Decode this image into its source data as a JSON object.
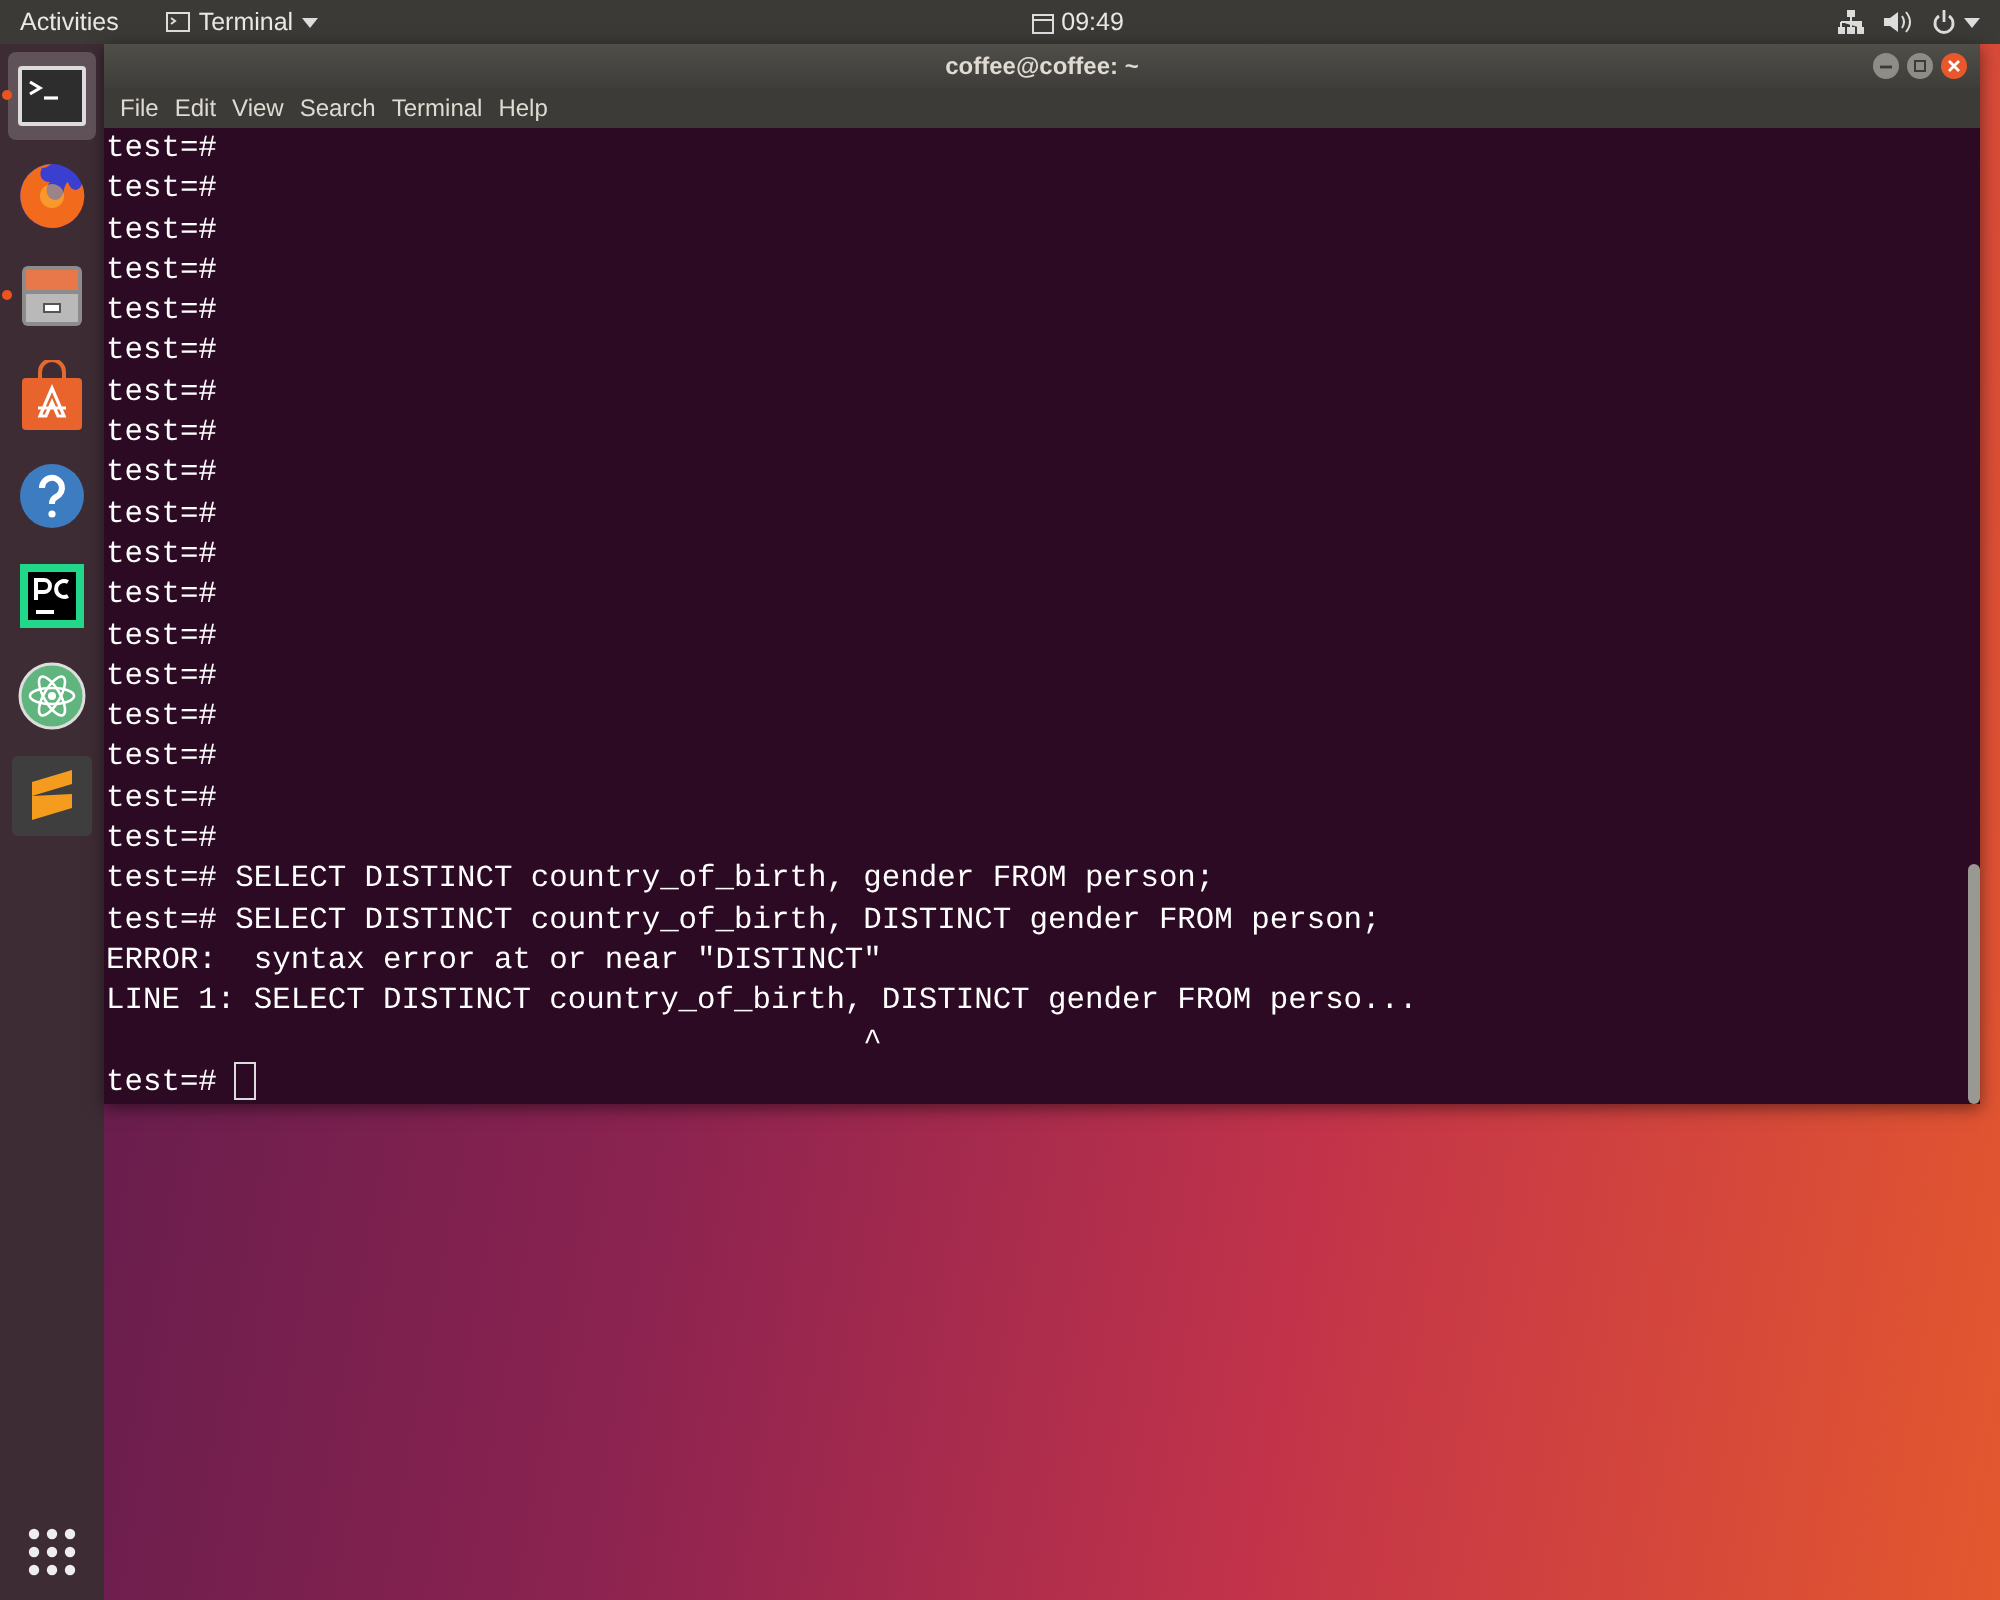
{
  "top_bar": {
    "activities": "Activities",
    "app_menu": "Terminal",
    "clock": "09:49"
  },
  "dock": {
    "apps": [
      {
        "kind": "terminal",
        "selected": true,
        "running": true
      },
      {
        "kind": "firefox",
        "selected": false,
        "running": false
      },
      {
        "kind": "files",
        "selected": false,
        "running": true
      },
      {
        "kind": "software",
        "selected": false,
        "running": false
      },
      {
        "kind": "help",
        "selected": false,
        "running": false
      },
      {
        "kind": "pycharm",
        "selected": false,
        "running": false
      },
      {
        "kind": "atom",
        "selected": false,
        "running": false
      },
      {
        "kind": "sublime",
        "selected": false,
        "running": false
      }
    ]
  },
  "window": {
    "title": "coffee@coffee: ~",
    "menu": [
      "File",
      "Edit",
      "View",
      "Search",
      "Terminal",
      "Help"
    ],
    "lines": [
      "test=#",
      "test=#",
      "test=#",
      "test=#",
      "test=#",
      "test=#",
      "test=#",
      "test=#",
      "test=#",
      "test=#",
      "test=#",
      "test=#",
      "test=#",
      "test=#",
      "test=#",
      "test=#",
      "test=#",
      "test=#",
      "test=# SELECT DISTINCT country_of_birth, gender FROM person;",
      "test=# SELECT DISTINCT country_of_birth, DISTINCT gender FROM person;",
      "ERROR:  syntax error at or near \"DISTINCT\"",
      "LINE 1: SELECT DISTINCT country_of_birth, DISTINCT gender FROM perso...",
      "                                         ^"
    ],
    "prompt": "test=#"
  }
}
